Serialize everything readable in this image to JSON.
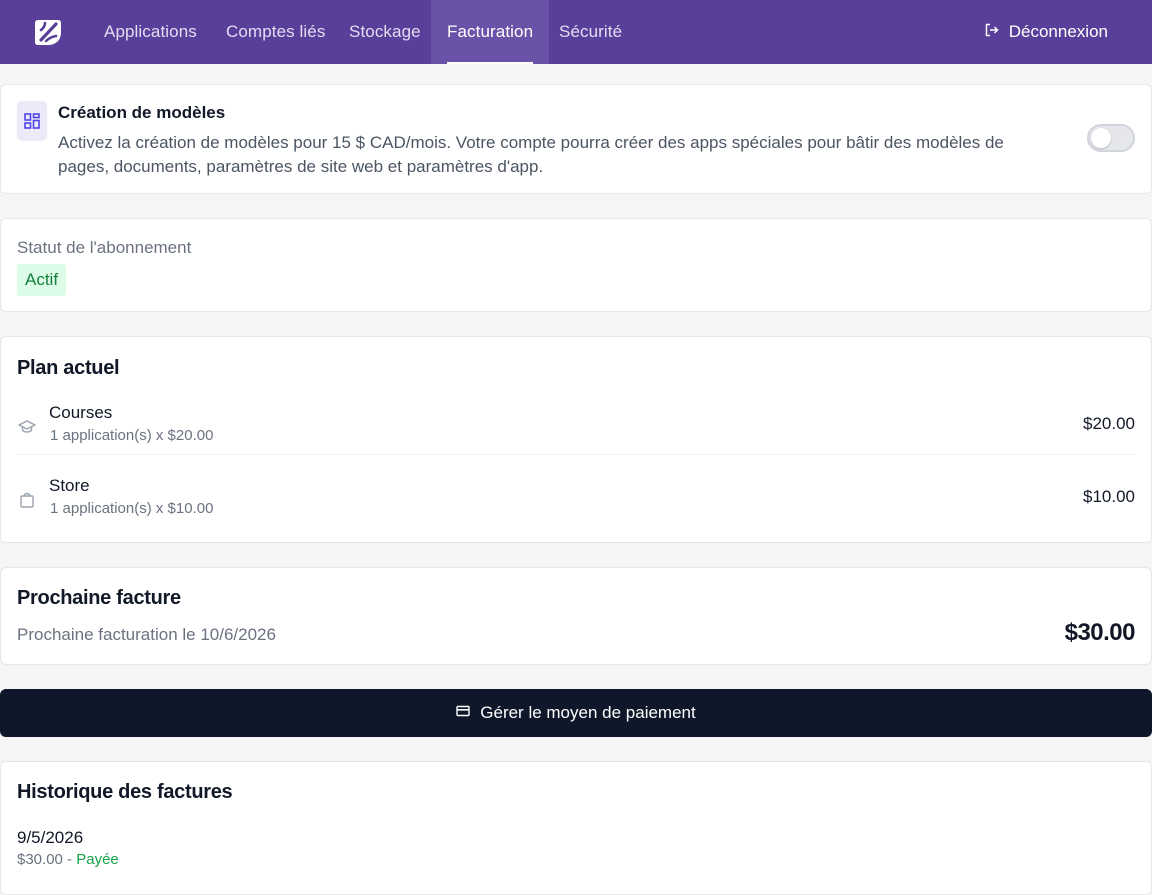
{
  "nav": {
    "logo_icon": "brand-logo",
    "tabs": [
      {
        "label": "Applications",
        "active": false
      },
      {
        "label": "Comptes liés",
        "active": false
      },
      {
        "label": "Stockage",
        "active": false
      },
      {
        "label": "Facturation",
        "active": true
      },
      {
        "label": "Sécurité",
        "active": false
      }
    ],
    "logout_label": "Déconnexion",
    "logout_icon": "logout-icon"
  },
  "templates": {
    "icon": "dashboard-icon",
    "title": "Création de modèles",
    "description": "Activez la création de modèles pour 15 $ CAD/mois. Votre compte pourra créer des apps spéciales pour bâtir des modèles de pages, documents, paramètres de site web et paramètres d'app.",
    "enabled": false
  },
  "subscription": {
    "label": "Statut de l'abonnement",
    "status": "Actif"
  },
  "plan": {
    "title": "Plan actuel",
    "items": [
      {
        "icon": "graduation-cap-icon",
        "name": "Courses",
        "detail": "1 application(s) x $20.00",
        "price": "$20.00"
      },
      {
        "icon": "shopping-bag-icon",
        "name": "Store",
        "detail": "1 application(s) x $10.00",
        "price": "$10.00"
      }
    ]
  },
  "next_invoice": {
    "title": "Prochaine facture",
    "subtitle": "Prochaine facturation le 10/6/2026",
    "total": "$30.00"
  },
  "payment_button": {
    "label": "Gérer le moyen de paiement",
    "icon": "credit-card-icon"
  },
  "history": {
    "title": "Historique des factures",
    "items": [
      {
        "date": "9/5/2026",
        "amount": "$30.00",
        "separator": " - ",
        "status": "Payée"
      }
    ]
  },
  "colors": {
    "nav_bg": "#5a3f9a",
    "nav_active_bg": "#6a52a8",
    "button_bg": "#0f172a",
    "status_green": "#15803d",
    "status_bg": "#dcfce7"
  }
}
